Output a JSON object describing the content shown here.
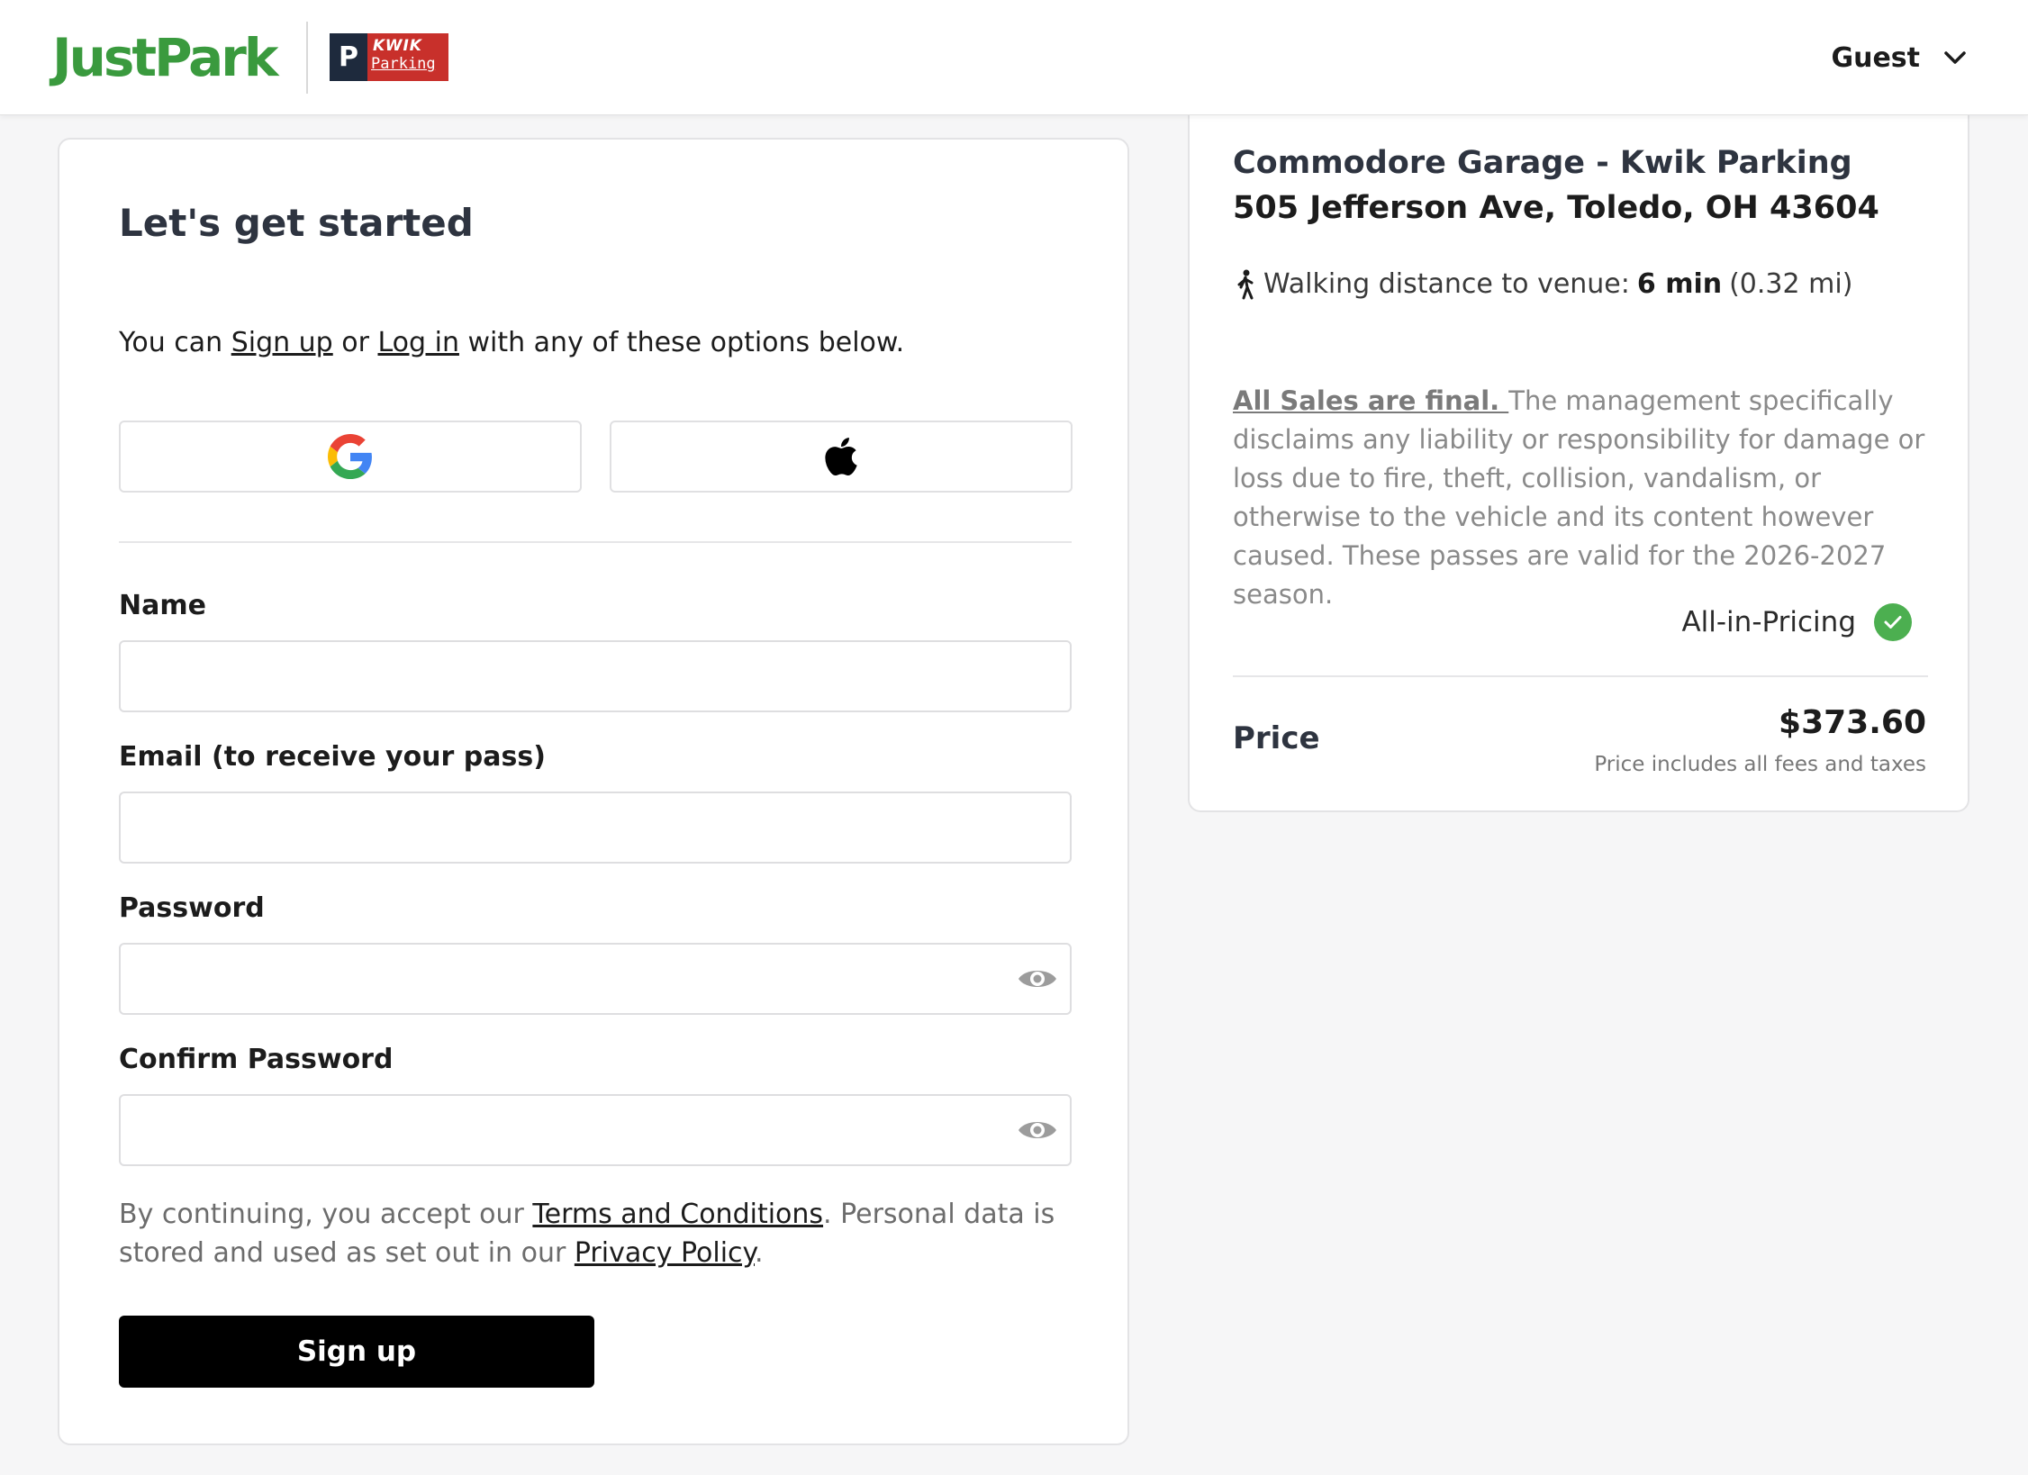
{
  "header": {
    "logo_justpark": "JustPark",
    "logo_p": "P",
    "logo_kwik": "KWIK",
    "logo_parking": "Parking",
    "guest_label": "Guest",
    "brand_green": "#3a9a3e"
  },
  "signup_form": {
    "title": "Let's get started",
    "intro_prefix": "You can ",
    "signup_link": "Sign up",
    "intro_or": " or ",
    "login_link": "Log in",
    "intro_suffix": " with any of these options below.",
    "social": [
      {
        "provider": "Google",
        "icon": "google-icon"
      },
      {
        "provider": "Apple",
        "icon": "apple-icon"
      }
    ],
    "name_label": "Name",
    "name_value": "",
    "email_label": "Email (to receive your pass)",
    "email_value": "",
    "password_label": "Password",
    "password_value": "",
    "confirm_password_label": "Confirm Password",
    "confirm_password_value": "",
    "terms_prefix": "By continuing, you accept our ",
    "terms_link": "Terms and Conditions",
    "terms_middle": ". Personal data is stored and used as set out in our ",
    "privacy_link": "Privacy Policy",
    "terms_suffix": ".",
    "submit_label": "Sign up"
  },
  "summary": {
    "venue_name": "Commodore Garage - Kwik Parking",
    "address": "505 Jefferson Ave, Toledo, OH 43604",
    "walking_prefix": "Walking distance to venue:",
    "walking_time": "6 min",
    "walking_distance": "(0.32 mi)",
    "disclaimer_link": "All Sales are final. ",
    "disclaimer_text": "The management specifically disclaims any liability or responsibility for damage or loss due to fire, theft, collision, vandalism, or otherwise to the vehicle and its content however caused. These passes are valid for the 2026-2027 season.",
    "all_in_pricing": "All-in-Pricing",
    "price_label": "Price",
    "price_value": "$373.60",
    "price_note": "Price includes all fees and taxes",
    "check_color": "#4caf50"
  }
}
